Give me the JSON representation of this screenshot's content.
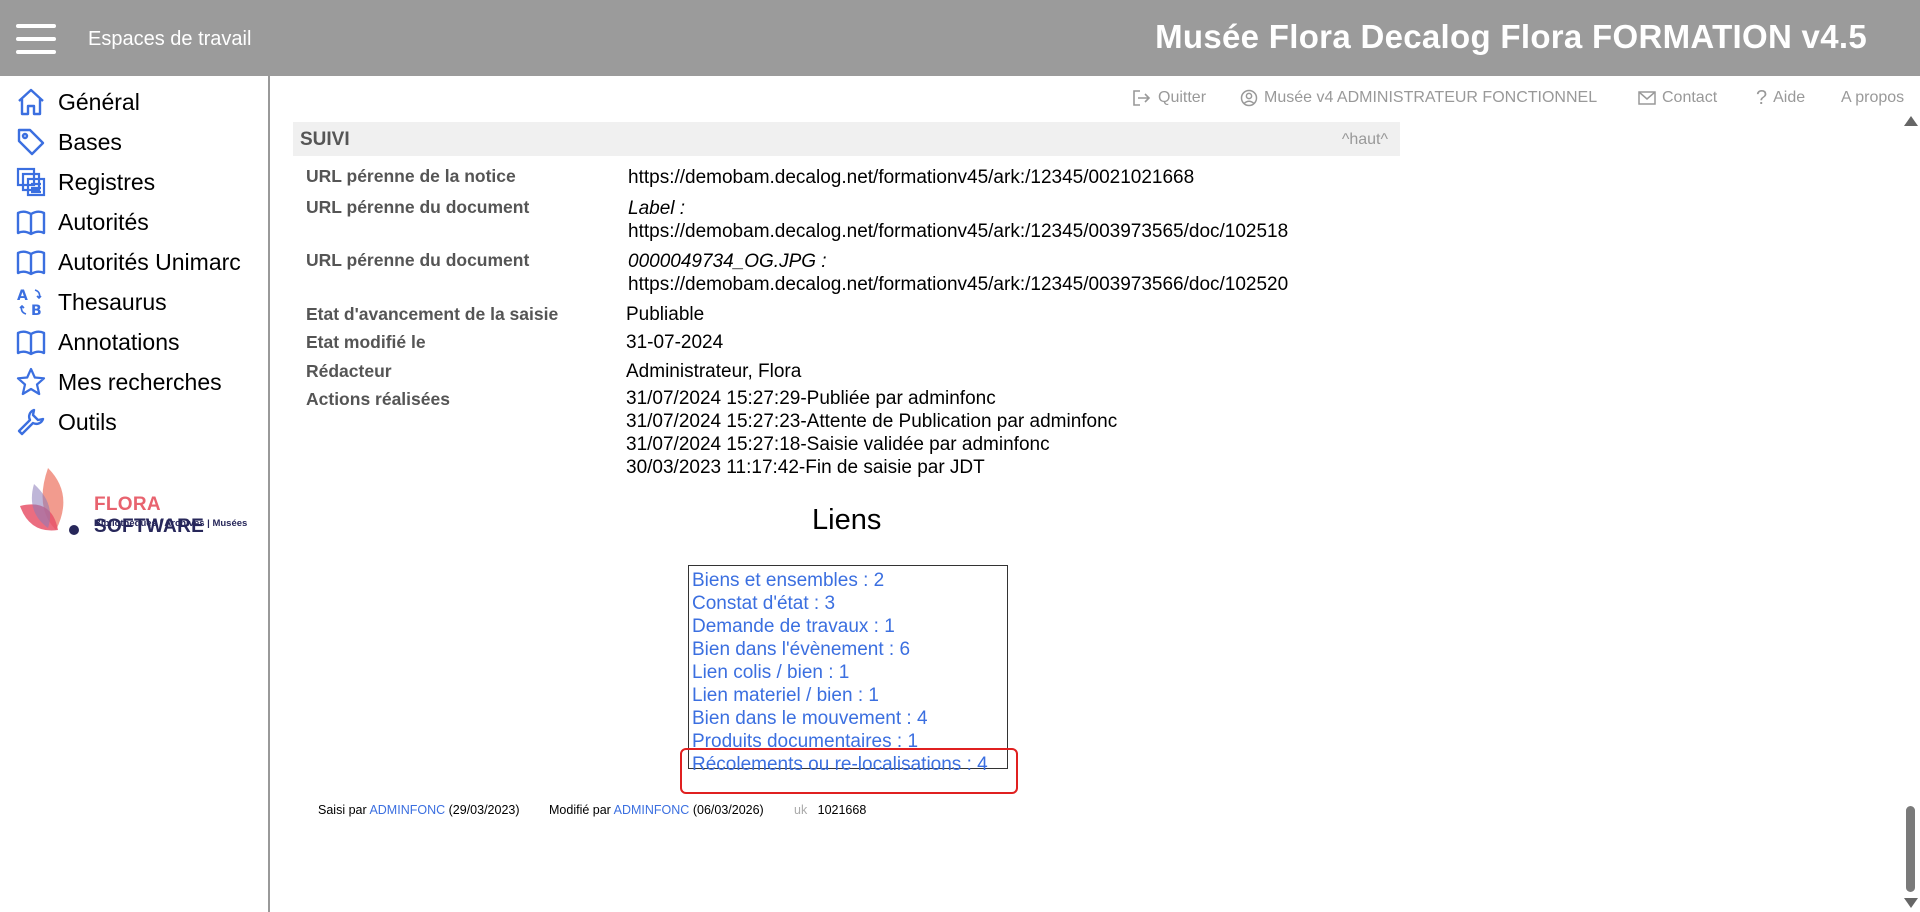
{
  "header": {
    "workspaces_label": "Espaces de travail",
    "app_title": "Musée Flora Decalog Flora FORMATION v4.5",
    "bar_color": "#9b9b9b"
  },
  "sidebar": {
    "items": [
      {
        "label": "Général",
        "icon": "home-icon"
      },
      {
        "label": "Bases",
        "icon": "tag-icon"
      },
      {
        "label": "Registres",
        "icon": "registers-icon"
      },
      {
        "label": "Autorités",
        "icon": "book-icon"
      },
      {
        "label": "Autorités Unimarc",
        "icon": "book-icon"
      },
      {
        "label": "Thesaurus",
        "icon": "sort-ab-icon"
      },
      {
        "label": "Annotations",
        "icon": "book-icon"
      },
      {
        "label": "Mes recherches",
        "icon": "star-icon"
      },
      {
        "label": "Outils",
        "icon": "wrench-icon"
      }
    ],
    "logo": {
      "brand1": "FLORA",
      "brand2": "SOFTWARE",
      "subtitle": "Bibliothèques | Archives | Musées"
    }
  },
  "top_links": {
    "quit": "Quitter",
    "user": "Musée v4 ADMINISTRATEUR FONCTIONNEL",
    "contact": "Contact",
    "help": "Aide",
    "about": "A propos"
  },
  "section": {
    "title": "SUIVI",
    "top_link": "^haut^"
  },
  "fields": {
    "url_notice": {
      "label": "URL pérenne de la notice",
      "value": "https://demobam.decalog.net/formationv45/ark:/12345/0021021668"
    },
    "url_doc1": {
      "label": "URL pérenne du document",
      "caption": "Label :",
      "value": "https://demobam.decalog.net/formationv45/ark:/12345/003973565/doc/102518"
    },
    "url_doc2": {
      "label": "URL pérenne du document",
      "caption": "0000049734_OG.JPG :",
      "value": "https://demobam.decalog.net/formationv45/ark:/12345/003973566/doc/102520"
    },
    "etat": {
      "label": "Etat d'avancement de la saisie",
      "value": "Publiable"
    },
    "etat_modifie": {
      "label": "Etat modifié le",
      "value": "31-07-2024"
    },
    "redacteur": {
      "label": "Rédacteur",
      "value": "Administrateur, Flora"
    },
    "actions": {
      "label": "Actions réalisées",
      "values": [
        "31/07/2024 15:27:29-Publiée par adminfonc",
        "31/07/2024 15:27:23-Attente de Publication par adminfonc",
        "31/07/2024 15:27:18-Saisie validée par adminfonc",
        "30/03/2023 11:17:42-Fin de saisie par JDT"
      ]
    }
  },
  "liens": {
    "title": "Liens",
    "items": [
      "Biens et ensembles : 2",
      "Constat d'état : 3",
      "Demande de travaux : 1",
      "Bien dans l'évènement : 6",
      "Lien colis / bien : 1",
      "Lien materiel / bien : 1",
      "Bien dans le mouvement : 4",
      "Produits documentaires : 1",
      "Récolements ou re-localisations : 4"
    ],
    "link_color": "#3b6fe0",
    "highlight_color": "#e02020"
  },
  "footer": {
    "saisi_label": "Saisi par",
    "saisi_user": "ADMINFONC",
    "saisi_date": "(29/03/2023)",
    "modifie_label": "Modifié par",
    "modifie_user": "ADMINFONC",
    "modifie_date": "(06/03/2026)",
    "uk_label": "uk",
    "uk_value": "1021668"
  }
}
